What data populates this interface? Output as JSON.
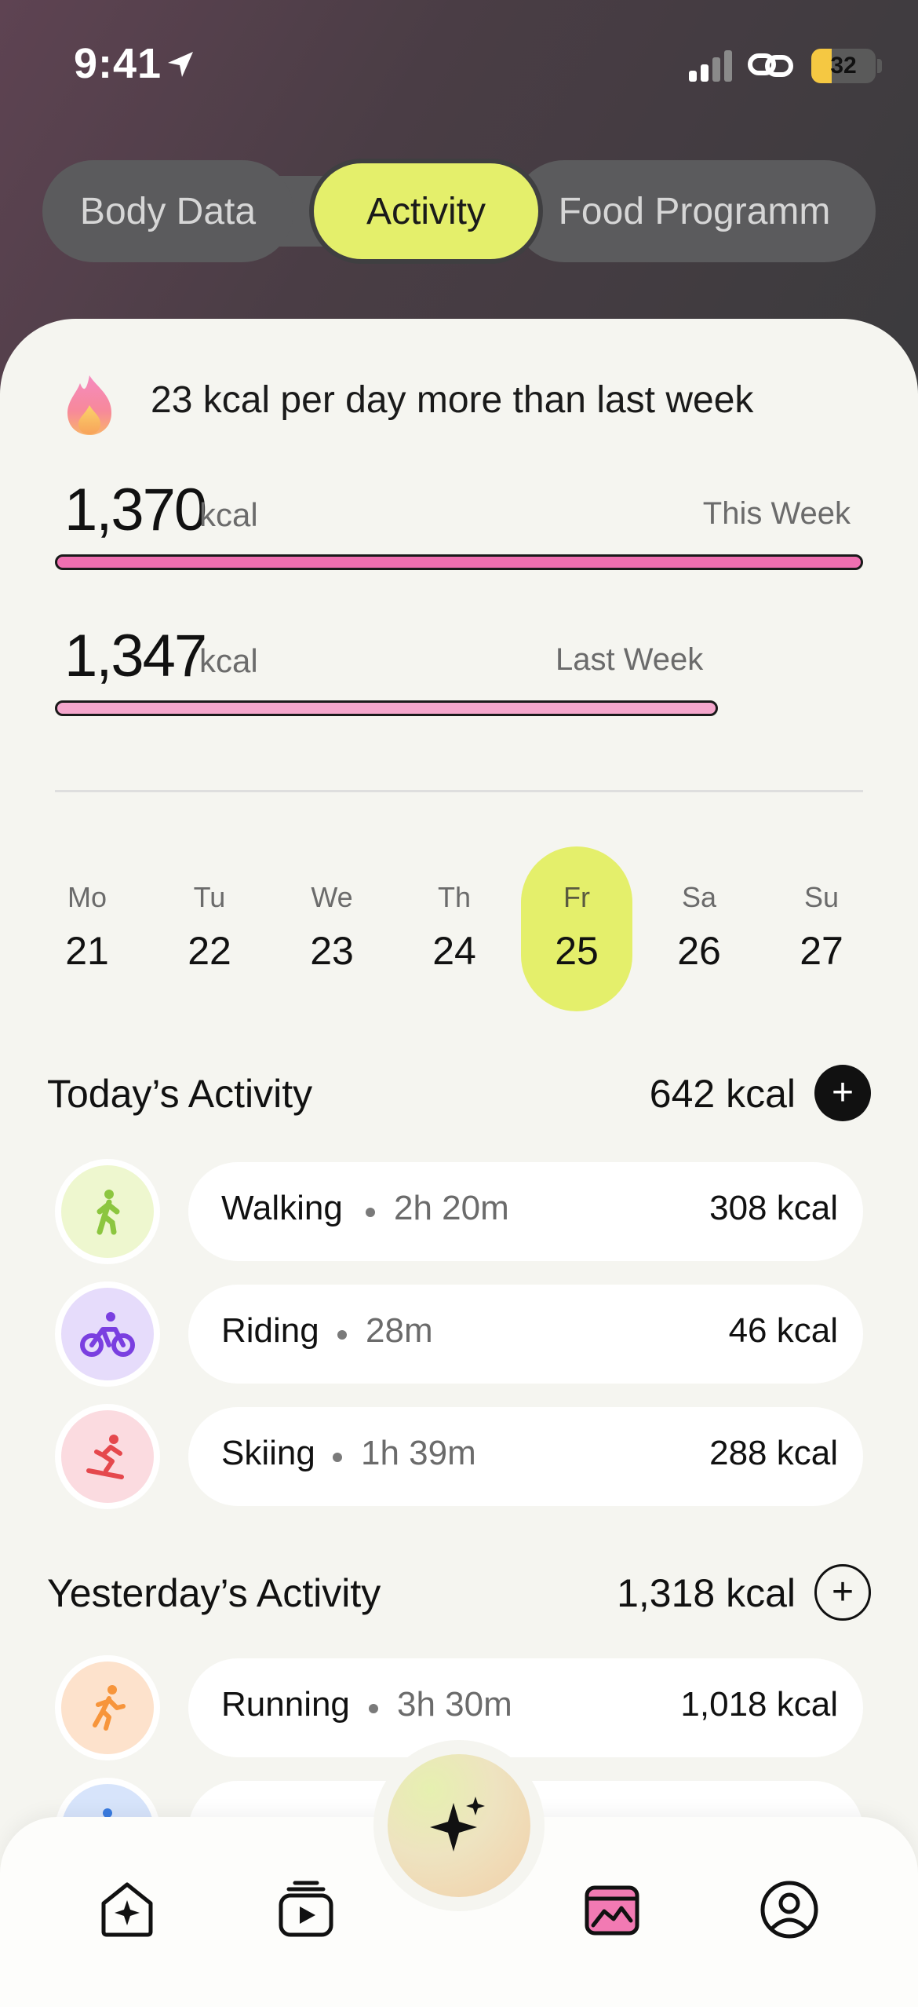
{
  "status_bar": {
    "time": "9:41",
    "battery": "32",
    "battery_level": 0.32
  },
  "tabs": [
    {
      "label": "Body Data",
      "active": false
    },
    {
      "label": "Activity",
      "active": true
    },
    {
      "label": "Food Programm",
      "active": false
    }
  ],
  "summary": {
    "headline": "23 kcal per day more than last week",
    "this_week": {
      "value": "1,370",
      "unit": "kcal",
      "label": "This Week",
      "fraction": 1.0
    },
    "last_week": {
      "value": "1,347",
      "unit": "kcal",
      "label": "Last Week",
      "fraction": 0.82
    }
  },
  "calendar": [
    {
      "dow": "Mo",
      "num": "21",
      "selected": false
    },
    {
      "dow": "Tu",
      "num": "22",
      "selected": false
    },
    {
      "dow": "We",
      "num": "23",
      "selected": false
    },
    {
      "dow": "Th",
      "num": "24",
      "selected": false
    },
    {
      "dow": "Fr",
      "num": "25",
      "selected": true
    },
    {
      "dow": "Sa",
      "num": "26",
      "selected": false
    },
    {
      "dow": "Su",
      "num": "27",
      "selected": false
    }
  ],
  "today": {
    "title": "Today’s Activity",
    "total": "642 kcal",
    "add": "+",
    "items": [
      {
        "name": "Walking",
        "duration": "2h 20m",
        "kcal": "308 kcal",
        "icon": "walking-icon",
        "color": "#eef7cf",
        "icon_color": "#8cc63f"
      },
      {
        "name": "Riding",
        "duration": "28m",
        "kcal": "46 kcal",
        "icon": "bicycle-icon",
        "color": "#e6dcfb",
        "icon_color": "#7a3fe0"
      },
      {
        "name": "Skiing",
        "duration": "1h 39m",
        "kcal": "288 kcal",
        "icon": "skiing-icon",
        "color": "#fbdbe0",
        "icon_color": "#e5484d"
      }
    ]
  },
  "yesterday": {
    "title": "Yesterday’s Activity",
    "total": "1,318 kcal",
    "add": "+",
    "items": [
      {
        "name": "Running",
        "duration": "3h 30m",
        "kcal": "1,018 kcal",
        "icon": "running-icon",
        "color": "#fde2cc",
        "icon_color": "#f7953b"
      }
    ]
  },
  "nav": {
    "items": [
      "home-icon",
      "play-icon",
      "sparkle-icon",
      "chart-card-icon",
      "profile-icon"
    ],
    "active_color": "#e8609f"
  }
}
